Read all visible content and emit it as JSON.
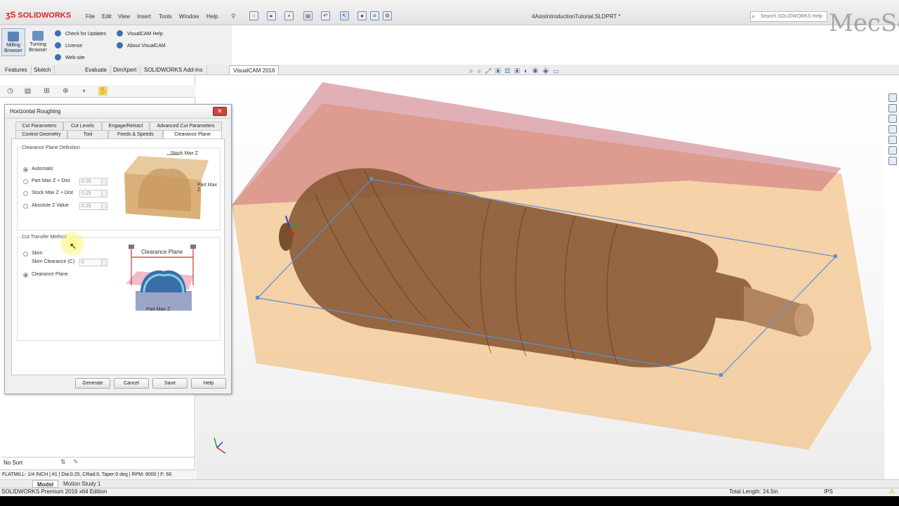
{
  "app": {
    "logo": "SOLIDWORKS",
    "document_title": "4AxisIntroductionTutorial.SLDPRT *"
  },
  "menu": [
    "File",
    "Edit",
    "View",
    "Insert",
    "Tools",
    "Window",
    "Help"
  ],
  "search": {
    "placeholder": "Search SOLIDWORKS Help"
  },
  "watermark": {
    "text": "MecSoft"
  },
  "command_manager": {
    "big_buttons": [
      {
        "label": "Milling Browser",
        "icon": "milling-browser-icon"
      },
      {
        "label": "Turning Browser",
        "icon": "turning-browser-icon"
      }
    ],
    "links": [
      "Check for Updates",
      "License",
      "Web-site",
      "VisualCAM Help",
      "About VisualCAM"
    ]
  },
  "command_tabs": [
    "Features",
    "Sketch",
    "Evaluate",
    "DimXpert",
    "SOLIDWORKS Add-Ins",
    "VisualCAM 2016"
  ],
  "active_command_tab": "VisualCAM 2016",
  "dialog": {
    "title": "Horizontal Roughing",
    "tabs_row1": [
      "Cut Parameters",
      "Cut Levels",
      "Engage/Retract",
      "Advanced Cut Parameters"
    ],
    "tabs_row2": [
      "Control Geometry",
      "Tool",
      "Feeds & Speeds",
      "Clearance Plane"
    ],
    "active_tab": "Clearance Plane",
    "clearance_group": {
      "label": "Clearance Plane Definition",
      "options": [
        {
          "label": "Automatic",
          "selected": true,
          "value": ""
        },
        {
          "label": "Part Max Z + Dist",
          "selected": false,
          "value": "0.25"
        },
        {
          "label": "Stock Max Z + Dist",
          "selected": false,
          "value": "0.25"
        },
        {
          "label": "Absolute Z Value",
          "selected": false,
          "value": "0.25"
        }
      ],
      "figure_labels": {
        "stock": "Stock Max Z",
        "part": "Part Max Z"
      }
    },
    "transfer_group": {
      "label": "Cut Transfer Method",
      "skim_label": "Skim",
      "skim_clearance_label": "Skim Clearance (C)",
      "skim_clearance_value": "0",
      "clearance_plane_label": "Clearance Plane",
      "skim_selected": false,
      "clearance_selected": true,
      "figure_labels": {
        "plane": "Clearance Plane",
        "part": "Part Max Z"
      }
    },
    "buttons": [
      "Generate",
      "Cancel",
      "Save",
      "Help"
    ]
  },
  "left_panel": {
    "sort_label": "No Sort",
    "tool_info": "FLATMILL- 1/4 INCH | #1 | Dia:0.25, CRad:0, Taper:0 deg | RPM: 8000 | F: 60"
  },
  "model_tabs": [
    "Model",
    "Motion Study 1"
  ],
  "status": {
    "edition": "SOLIDWORKS Premium 2016 x64 Edition",
    "total_length": "Total Length: 24.5in",
    "units": "IPS"
  }
}
